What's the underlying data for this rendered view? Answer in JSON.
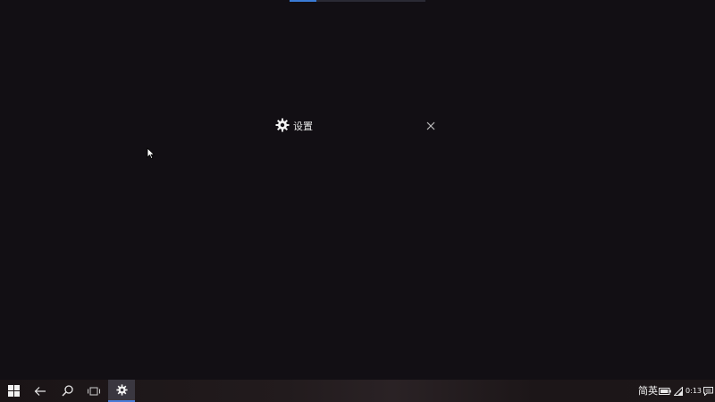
{
  "splash": {
    "title": "设置",
    "icon": "gear-icon",
    "close_icon": "close-icon"
  },
  "progress": {
    "value": 0.2
  },
  "taskbar": {
    "start_icon": "windows-icon",
    "back_icon": "back-arrow-icon",
    "search_icon": "search-icon",
    "task_view_icon": "task-view-icon",
    "settings_icon": "gear-icon",
    "accent_color": "#4a7bd8"
  },
  "tray": {
    "ime_label": "简英",
    "battery_icon": "battery-icon",
    "wifi_icon": "wifi-icon",
    "clock": "0:13",
    "notification_icon": "notification-icon"
  },
  "colors": {
    "background": "#120f14",
    "progress": "#3a7bd5"
  }
}
